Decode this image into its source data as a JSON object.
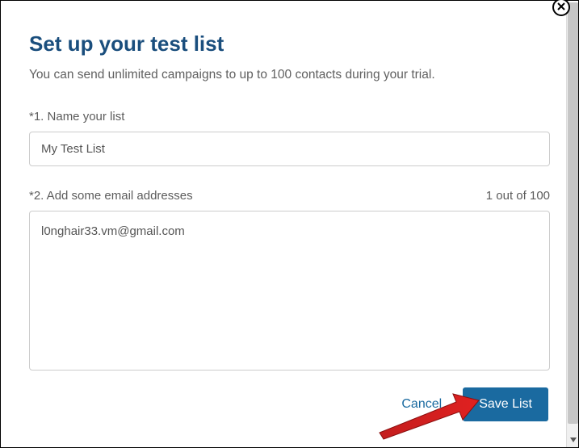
{
  "dialog": {
    "title": "Set up your test list",
    "subtitle": "You can send unlimited campaigns to up to 100 contacts during your trial.",
    "field1": {
      "label": "*1. Name your list",
      "value": "My Test List"
    },
    "field2": {
      "label": "*2. Add some email addresses",
      "counter": "1 out of 100",
      "value": "l0nghair33.vm@gmail.com"
    },
    "actions": {
      "cancel": "Cancel",
      "save": "Save List"
    }
  }
}
